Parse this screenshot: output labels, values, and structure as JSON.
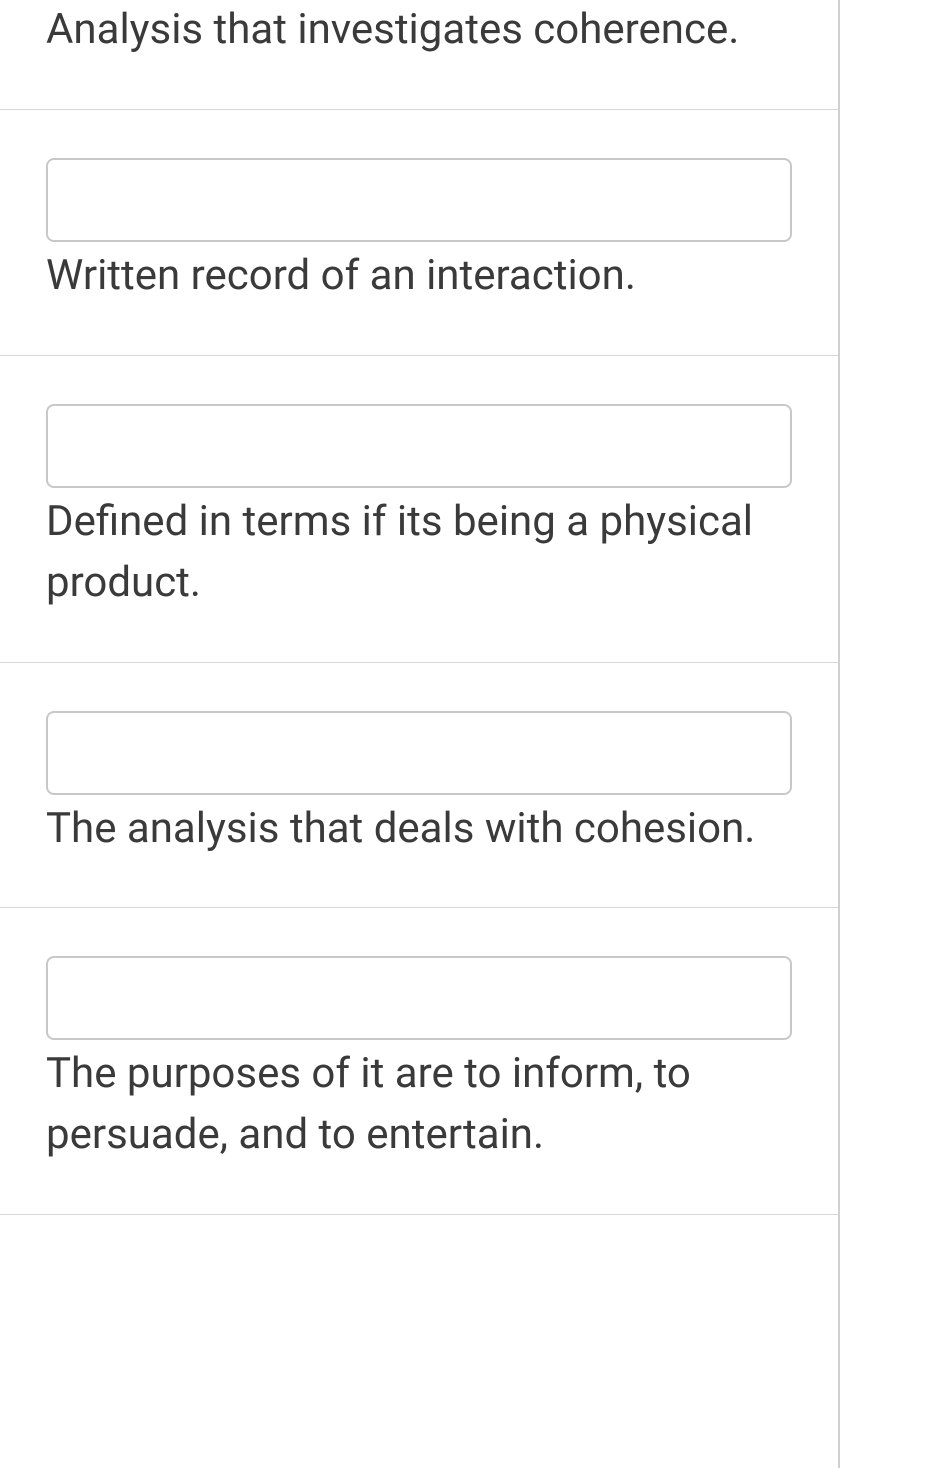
{
  "items": [
    {
      "clue": "Analysis that investigates coherence.",
      "value": ""
    },
    {
      "clue": "Written record of an interaction.",
      "value": ""
    },
    {
      "clue": "Defined in terms if its being a physical product.",
      "value": ""
    },
    {
      "clue": "The analysis that deals with cohesion.",
      "value": ""
    },
    {
      "clue": "The purposes of it are to inform, to persuade, and to entertain.",
      "value": ""
    }
  ]
}
